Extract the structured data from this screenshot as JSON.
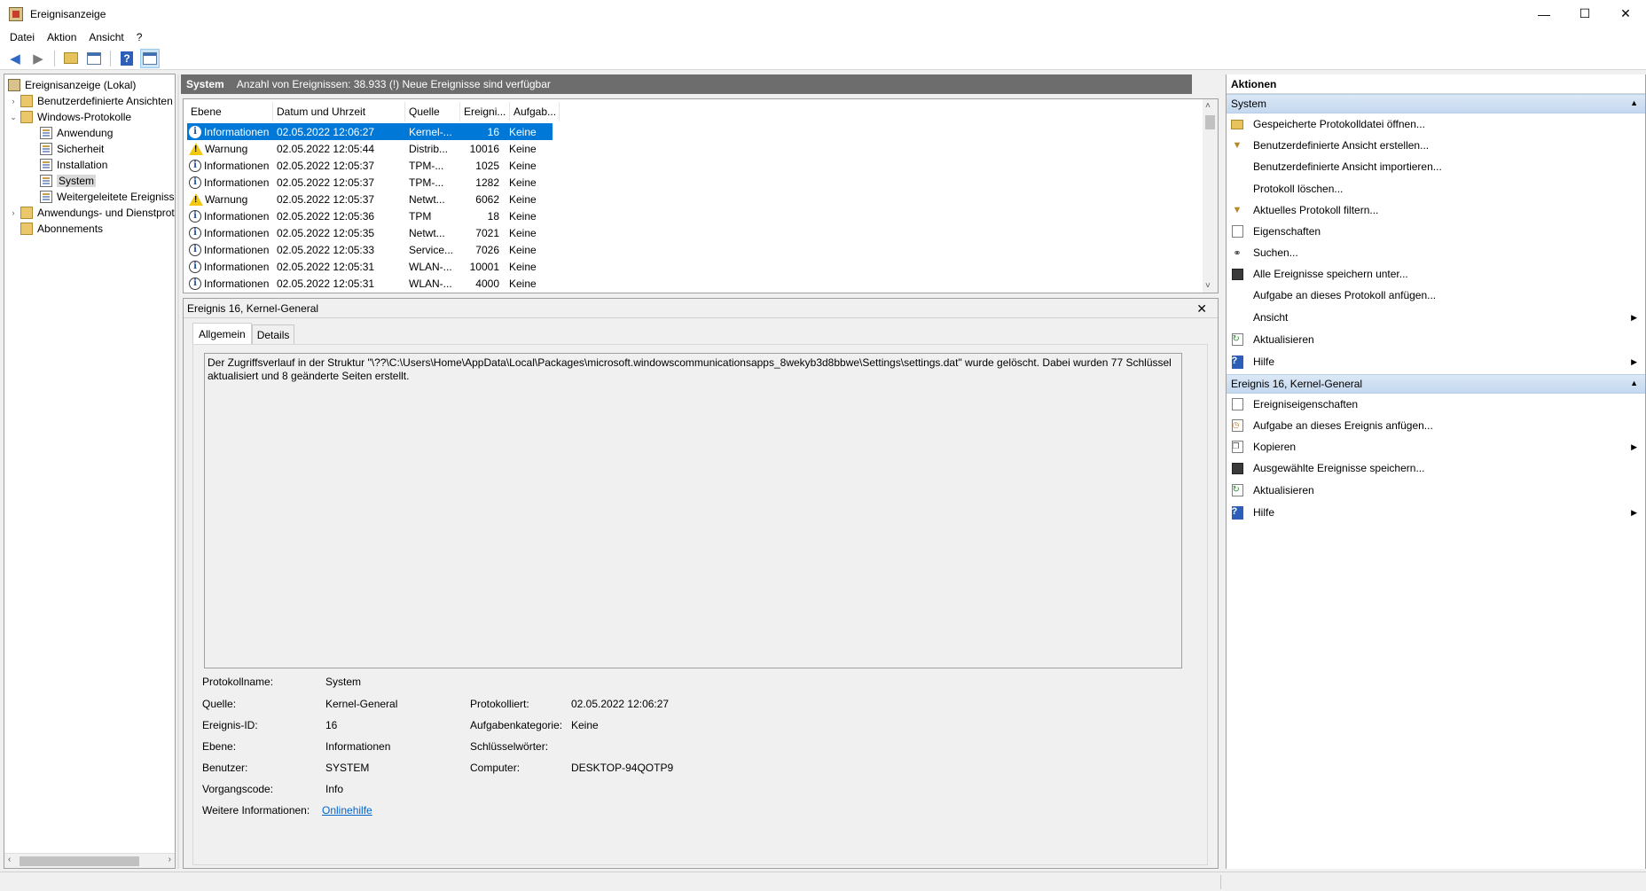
{
  "window": {
    "title": "Ereignisanzeige",
    "minimize": "—",
    "maximize": "☐",
    "close": "✕"
  },
  "menu": [
    "Datei",
    "Aktion",
    "Ansicht",
    "?"
  ],
  "toolbar": {
    "icons": [
      "back-arrow-icon",
      "forward-arrow-icon",
      "up-folder-icon",
      "show-hide-console-tree-icon",
      "help-icon",
      "show-hide-action-pane-icon"
    ]
  },
  "tree": {
    "root": "Ereignisanzeige (Lokal)",
    "items": [
      {
        "label": "Benutzerdefinierte Ansichten",
        "expander": "›"
      },
      {
        "label": "Windows-Protokolle",
        "expander": "⌄"
      },
      {
        "label": "Anwendung"
      },
      {
        "label": "Sicherheit"
      },
      {
        "label": "Installation"
      },
      {
        "label": "System"
      },
      {
        "label": "Weitergeleitete Ereignisse"
      },
      {
        "label": "Anwendungs- und Dienstprotokolle",
        "expander": "›"
      },
      {
        "label": "Abonnements"
      }
    ]
  },
  "center_header": {
    "name": "System",
    "info": "Anzahl von Ereignissen: 38.933 (!) Neue Ereignisse sind verfügbar"
  },
  "event_list": {
    "columns": [
      "Ebene",
      "Datum und Uhrzeit",
      "Quelle",
      "Ereigni...",
      "Aufgab..."
    ],
    "rows": [
      {
        "level": "Informationen",
        "type": "info",
        "datetime": "02.05.2022 12:06:27",
        "source": "Kernel-...",
        "id": "16",
        "task": "Keine"
      },
      {
        "level": "Warnung",
        "type": "warn",
        "datetime": "02.05.2022 12:05:44",
        "source": "Distrib...",
        "id": "10016",
        "task": "Keine"
      },
      {
        "level": "Informationen",
        "type": "info",
        "datetime": "02.05.2022 12:05:37",
        "source": "TPM-...",
        "id": "1025",
        "task": "Keine"
      },
      {
        "level": "Informationen",
        "type": "info",
        "datetime": "02.05.2022 12:05:37",
        "source": "TPM-...",
        "id": "1282",
        "task": "Keine"
      },
      {
        "level": "Warnung",
        "type": "warn",
        "datetime": "02.05.2022 12:05:37",
        "source": "Netwt...",
        "id": "6062",
        "task": "Keine"
      },
      {
        "level": "Informationen",
        "type": "info",
        "datetime": "02.05.2022 12:05:36",
        "source": "TPM",
        "id": "18",
        "task": "Keine"
      },
      {
        "level": "Informationen",
        "type": "info",
        "datetime": "02.05.2022 12:05:35",
        "source": "Netwt...",
        "id": "7021",
        "task": "Keine"
      },
      {
        "level": "Informationen",
        "type": "info",
        "datetime": "02.05.2022 12:05:33",
        "source": "Service...",
        "id": "7026",
        "task": "Keine"
      },
      {
        "level": "Informationen",
        "type": "info",
        "datetime": "02.05.2022 12:05:31",
        "source": "WLAN-...",
        "id": "10001",
        "task": "Keine"
      },
      {
        "level": "Informationen",
        "type": "info",
        "datetime": "02.05.2022 12:05:31",
        "source": "WLAN-...",
        "id": "4000",
        "task": "Keine"
      }
    ]
  },
  "detail": {
    "title": "Ereignis 16, Kernel-General",
    "close": "✕",
    "tabs": [
      "Allgemein",
      "Details"
    ],
    "message": "Der Zugriffsverlauf in der Struktur \"\\??\\C:\\Users\\Home\\AppData\\Local\\Packages\\microsoft.windowscommunicationsapps_8wekyb3d8bbwe\\Settings\\settings.dat\" wurde gelöscht. Dabei wurden 77 Schlüssel aktualisiert und 8 geänderte Seiten erstellt.",
    "props": {
      "protokollname_label": "Protokollname:",
      "protokollname": "System",
      "quelle_label": "Quelle:",
      "quelle": "Kernel-General",
      "protokolliert_label": "Protokolliert:",
      "protokolliert": "02.05.2022 12:06:27",
      "ereignisid_label": "Ereignis-ID:",
      "ereignisid": "16",
      "aufgabenkategorie_label": "Aufgabenkategorie:",
      "aufgabenkategorie": "Keine",
      "ebene_label": "Ebene:",
      "ebene": "Informationen",
      "schluesselwoerter_label": "Schlüsselwörter:",
      "schluesselwoerter": "",
      "benutzer_label": "Benutzer:",
      "benutzer": "SYSTEM",
      "computer_label": "Computer:",
      "computer": "DESKTOP-94QOTP9",
      "vorgangscode_label": "Vorgangscode:",
      "vorgangscode": "Info",
      "weitere_label": "Weitere Informationen:",
      "weitere_link": "Onlinehilfe"
    }
  },
  "actions": {
    "title": "Aktionen",
    "section1": {
      "title": "System",
      "items": [
        {
          "label": "Gespeicherte Protokolldatei öffnen...",
          "icon": "open-folder-icon"
        },
        {
          "label": "Benutzerdefinierte Ansicht erstellen...",
          "icon": "filter-icon"
        },
        {
          "label": "Benutzerdefinierte Ansicht importieren...",
          "icon": ""
        },
        {
          "label": "Protokoll löschen...",
          "icon": ""
        },
        {
          "label": "Aktuelles Protokoll filtern...",
          "icon": "filter-icon"
        },
        {
          "label": "Eigenschaften",
          "icon": "properties-icon"
        },
        {
          "label": "Suchen...",
          "icon": "binoculars-icon"
        },
        {
          "label": "Alle Ereignisse speichern unter...",
          "icon": "save-icon"
        },
        {
          "label": "Aufgabe an dieses Protokoll anfügen...",
          "icon": ""
        },
        {
          "label": "Ansicht",
          "icon": "",
          "submenu": true
        },
        {
          "label": "Aktualisieren",
          "icon": "refresh-icon"
        },
        {
          "label": "Hilfe",
          "icon": "help-icon",
          "submenu": true
        }
      ]
    },
    "section2": {
      "title": "Ereignis 16, Kernel-General",
      "items": [
        {
          "label": "Ereigniseigenschaften",
          "icon": "properties-icon"
        },
        {
          "label": "Aufgabe an dieses Ereignis anfügen...",
          "icon": "task-icon"
        },
        {
          "label": "Kopieren",
          "icon": "copy-icon",
          "submenu": true
        },
        {
          "label": "Ausgewählte Ereignisse speichern...",
          "icon": "save-icon"
        },
        {
          "label": "Aktualisieren",
          "icon": "refresh-icon"
        },
        {
          "label": "Hilfe",
          "icon": "help-icon",
          "submenu": true
        }
      ]
    }
  }
}
